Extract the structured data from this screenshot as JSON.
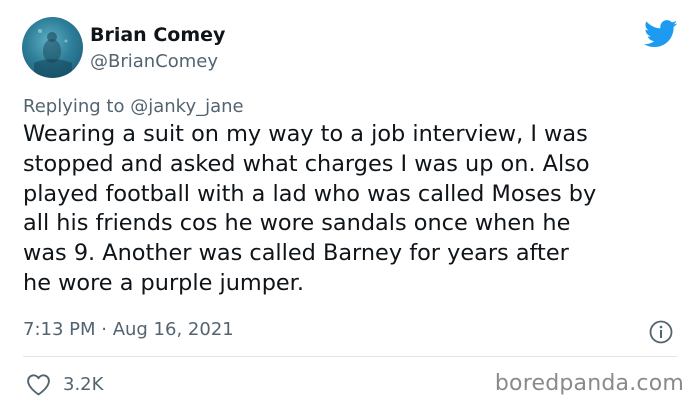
{
  "author": {
    "display_name": "Brian Comey",
    "handle": "@BrianComey"
  },
  "reply": {
    "prefix": "Replying to",
    "mention": "@janky_jane"
  },
  "tweet": {
    "lines": [
      "Wearing a suit on my way to a job interview, I was",
      "stopped and asked what charges I was up on. Also",
      "played football with a lad who was called Moses by",
      "all his friends cos he wore sandals once when he",
      "was 9. Another was called Barney for years after",
      "he wore a purple jumper."
    ],
    "timestamp": "7:13 PM · Aug 16, 2021",
    "like_count": "3.2K"
  },
  "watermark": "boredpanda.com",
  "icons": {
    "logo": "twitter-bird-icon",
    "info": "info-icon",
    "like": "heart-icon"
  },
  "colors": {
    "twitter_blue": "#1d9bf0",
    "secondary_text": "#536471",
    "primary_text": "#0f1419"
  }
}
